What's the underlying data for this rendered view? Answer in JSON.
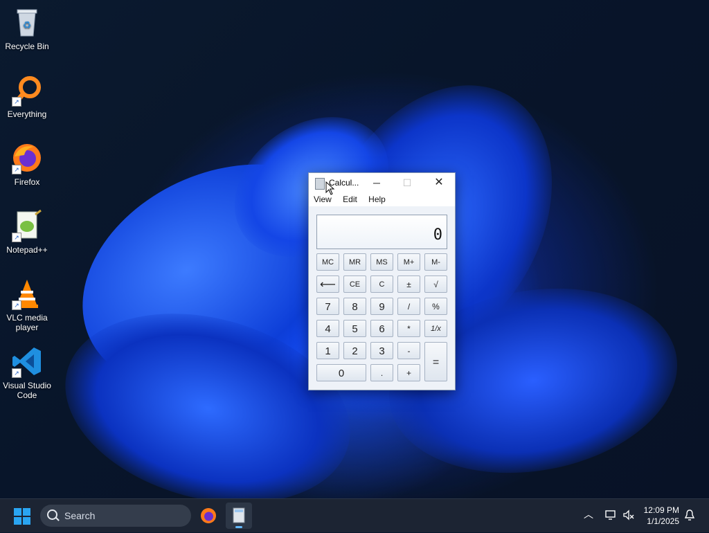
{
  "desktop": {
    "icons": [
      {
        "label": "Recycle Bin",
        "icon": "recycle-bin-icon"
      },
      {
        "label": "Everything",
        "icon": "everything-icon"
      },
      {
        "label": "Firefox",
        "icon": "firefox-icon"
      },
      {
        "label": "Notepad++",
        "icon": "notepad-plus-plus-icon"
      },
      {
        "label": "VLC media player",
        "icon": "vlc-icon"
      },
      {
        "label": "Visual Studio Code",
        "icon": "vscode-icon"
      }
    ]
  },
  "calculator": {
    "title": "Calcul...",
    "menu": [
      "View",
      "Edit",
      "Help"
    ],
    "display": "0",
    "buttons": {
      "mc": "MC",
      "mr": "MR",
      "ms": "MS",
      "mplus": "M+",
      "mminus": "M-",
      "back": "⟵",
      "ce": "CE",
      "c": "C",
      "plusminus": "±",
      "sqrt": "√",
      "seven": "7",
      "eight": "8",
      "nine": "9",
      "divide": "/",
      "percent": "%",
      "four": "4",
      "five": "5",
      "six": "6",
      "multiply": "*",
      "reciprocal": "1/x",
      "one": "1",
      "two": "2",
      "three": "3",
      "minus": "-",
      "equals": "=",
      "zero": "0",
      "decimal": ".",
      "plus": "+"
    }
  },
  "taskbar": {
    "search_placeholder": "Search",
    "time": "12:09 PM",
    "date": "1/1/2025"
  },
  "colors": {
    "taskbar": "#1c2433",
    "accent": "#2aa5f2"
  }
}
